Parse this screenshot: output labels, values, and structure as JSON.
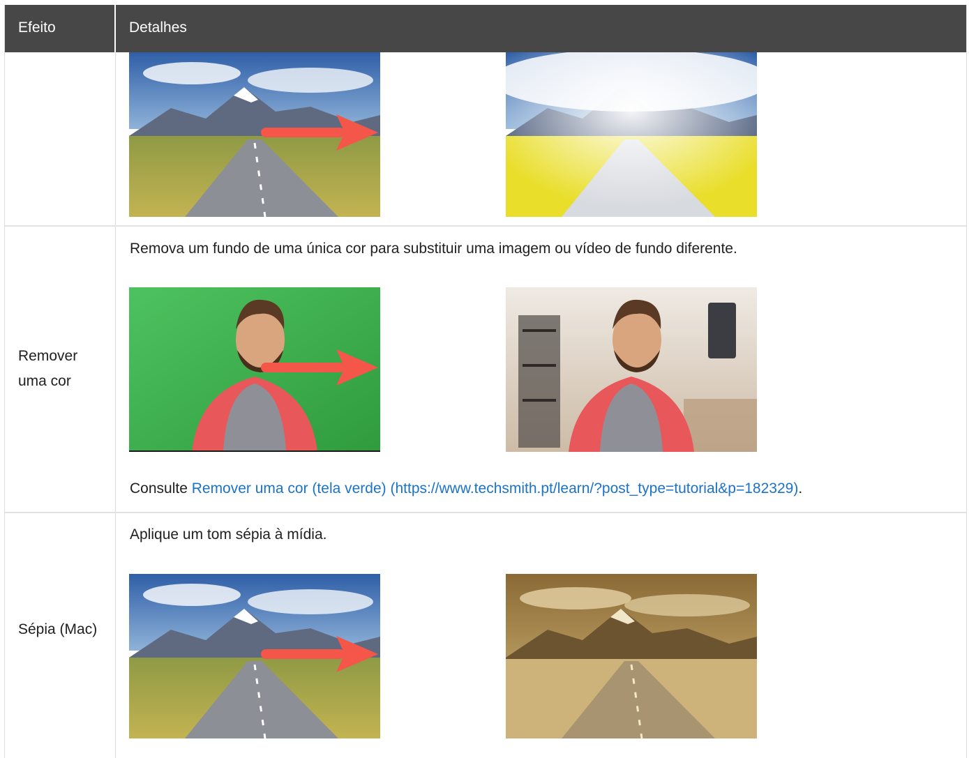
{
  "header": {
    "col_effect": "Efeito",
    "col_details": "Detalhes"
  },
  "rows": [
    {
      "effect": "",
      "images": {
        "before": "landscape-road-photo",
        "arrow": "right-arrow-icon",
        "after": "landscape-glow-photo"
      }
    },
    {
      "effect": "Remover uma cor",
      "description": "Remova um fundo de uma única cor para substituir uma imagem ou vídeo de fundo diferente.",
      "images": {
        "before": "green-screen-presenter-photo",
        "arrow": "right-arrow-icon",
        "after": "presenter-room-background-photo"
      },
      "see_prefix": "Consulte ",
      "link_text": "Remover uma cor (tela verde) (https://www.techsmith.pt/learn/?post_type=tutorial&p=182329)",
      "see_suffix": "."
    },
    {
      "effect": "Sépia (Mac)",
      "description": "Aplique um tom sépia à mídia.",
      "images": {
        "before": "landscape-road-photo",
        "arrow": "right-arrow-icon",
        "after": "landscape-sepia-photo"
      }
    }
  ],
  "colors": {
    "header_bg": "#474747",
    "arrow": "#f4564a",
    "link": "#1a73c8",
    "green_screen": "#3bab4a",
    "sepia": "#c2a468"
  }
}
